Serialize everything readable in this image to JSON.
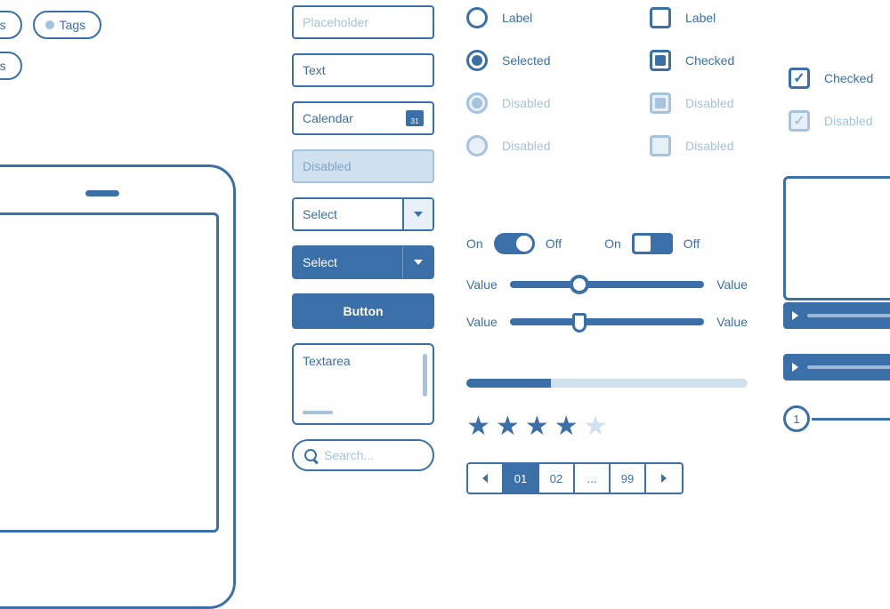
{
  "tags": {
    "text1": "ags",
    "text2": "Tags",
    "text3": "ags"
  },
  "inputs": {
    "placeholder": "Placeholder",
    "text": "Text",
    "calendar": "Calendar",
    "disabled": "Disabled",
    "select1": "Select",
    "select2": "Select",
    "button": "Button",
    "textarea": "Textarea",
    "search": "Search..."
  },
  "radios": {
    "r1": "Label",
    "r2": "Selected",
    "r3": "Disabled",
    "r4": "Disabled"
  },
  "checks": {
    "c1": "Label",
    "c2": "Checked",
    "c3": "Disabled",
    "c4": "Disabled"
  },
  "checks2": {
    "cm1": "Checked",
    "cm2": "Disabled"
  },
  "toggles": {
    "on": "On",
    "off": "Off"
  },
  "sliders": {
    "left": "Value",
    "right": "Value"
  },
  "pagination": {
    "p1": "01",
    "p2": "02",
    "p3": "...",
    "p4": "99"
  },
  "step": {
    "n1": "1"
  }
}
